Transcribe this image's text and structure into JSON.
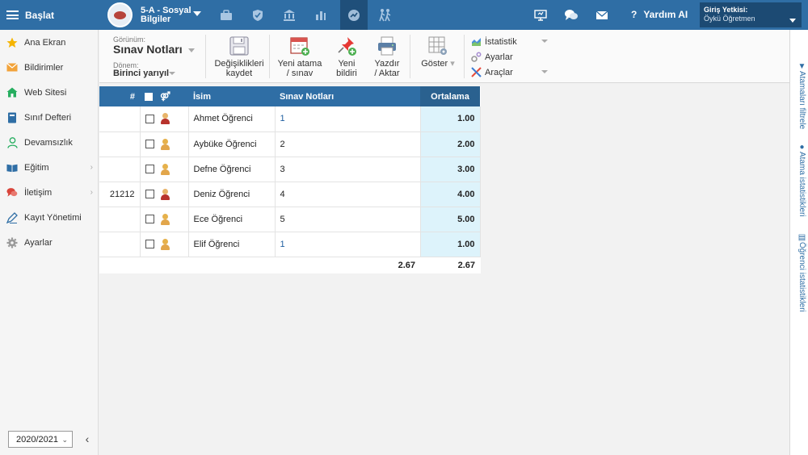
{
  "topbar": {
    "menu_label": "Başlat",
    "class_line1": "5-A - Sosyal",
    "class_line2": "Bilgiler",
    "help_label": "Yardım AI",
    "auth_title": "Giriş Yetkisi:",
    "auth_user": "Öykü Öğretmen",
    "icons": [
      "briefcase-icon",
      "shield-icon",
      "institution-icon",
      "bar-chart-icon",
      "gauge-icon",
      "people-walking-icon"
    ],
    "right_icons": [
      "presentation-icon",
      "chat-icon",
      "mail-icon"
    ]
  },
  "sidebar": {
    "items": [
      {
        "label": "Ana Ekran",
        "icon": "star-icon",
        "color": "#f5b400"
      },
      {
        "label": "Bildirimler",
        "icon": "envelope-icon",
        "color": "#f2a33a"
      },
      {
        "label": "Web Sitesi",
        "icon": "home-icon",
        "color": "#27ae60"
      },
      {
        "label": "Sınıf Defteri",
        "icon": "notebook-icon",
        "color": "#2f6ea5"
      },
      {
        "label": "Devamsızlık",
        "icon": "person-icon",
        "color": "#27ae60"
      },
      {
        "label": "Eğitim",
        "icon": "book-icon",
        "color": "#2f6ea5"
      },
      {
        "label": "İletişim",
        "icon": "speech-icon",
        "color": "#d9453b"
      },
      {
        "label": "Kayıt Yönetimi",
        "icon": "pen-icon",
        "color": "#2f6ea5"
      },
      {
        "label": "Ayarlar",
        "icon": "gear-icon",
        "color": "#888888"
      }
    ],
    "year": "2020/2021"
  },
  "toolbar": {
    "view_label": "Görünüm:",
    "view_value": "Sınav Notları",
    "period_label": "Dönem:",
    "period_value": "Birinci yarıyıl",
    "save_line1": "Değişiklikleri",
    "save_line2": "kaydet",
    "new_assign_line1": "Yeni atama",
    "new_assign_line2": "/ sınav",
    "new_notice_line1": "Yeni",
    "new_notice_line2": "bildiri",
    "print_line1": "Yazdır",
    "print_line2": "/ Aktar",
    "show_label": "Göster",
    "menu": {
      "stats": "İstatistik",
      "settings": "Ayarlar",
      "tools": "Araçlar"
    }
  },
  "right_panel": {
    "tab1": "Atamaları filtrele",
    "tab2": "Atama istatistikleri",
    "tab3": "Öğrenci istatistikleri"
  },
  "table": {
    "headers": {
      "num": "#",
      "name": "İsim",
      "grades": "Sınav Notları",
      "avg": "Ortalama"
    },
    "rows": [
      {
        "num": "",
        "name": "Ahmet Öğrenci",
        "grade": "1",
        "avg": "1.00",
        "gender": "male"
      },
      {
        "num": "",
        "name": "Aybüke Öğrenci",
        "grade": "2",
        "avg": "2.00",
        "gender": "female"
      },
      {
        "num": "",
        "name": "Defne Öğrenci",
        "grade": "3",
        "avg": "3.00",
        "gender": "female"
      },
      {
        "num": "21212",
        "name": "Deniz Öğrenci",
        "grade": "4",
        "avg": "4.00",
        "gender": "male"
      },
      {
        "num": "",
        "name": "Ece Öğrenci",
        "grade": "5",
        "avg": "5.00",
        "gender": "female"
      },
      {
        "num": "",
        "name": "Elif Öğrenci",
        "grade": "1",
        "avg": "1.00",
        "gender": "female"
      }
    ],
    "footer": {
      "grades_avg": "2.67",
      "avg": "2.67"
    }
  }
}
